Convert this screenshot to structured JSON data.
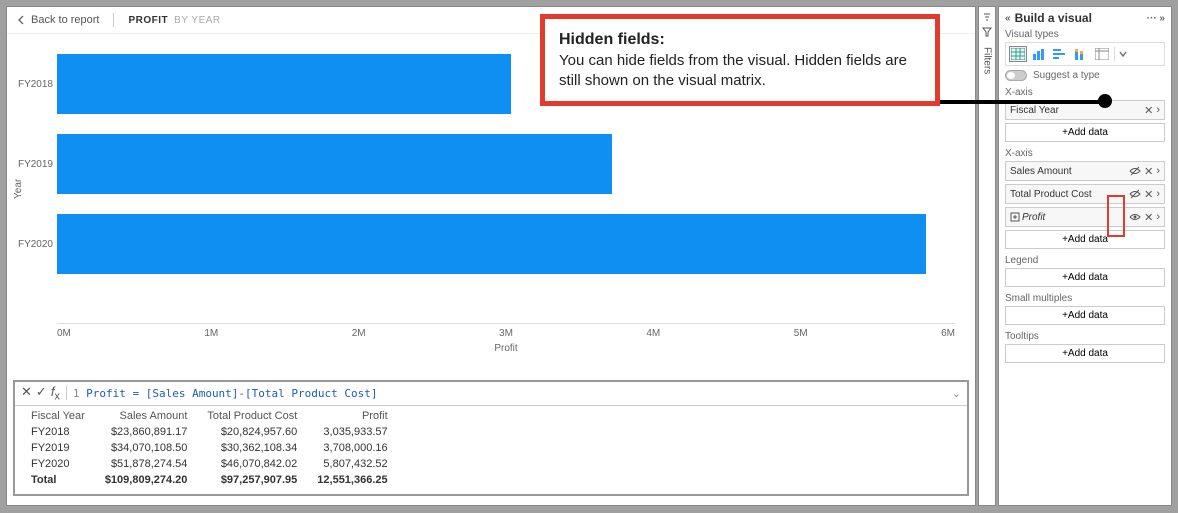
{
  "header": {
    "back_label": "Back to report",
    "crumb_active": "PROFIT",
    "crumb_inactive": "BY YEAR"
  },
  "callout": {
    "title": "Hidden fields:",
    "body": "You can hide fields from the visual. Hidden fields are still shown on the visual matrix."
  },
  "chart_data": {
    "type": "bar",
    "orientation": "horizontal",
    "categories": [
      "FY2018",
      "FY2019",
      "FY2020"
    ],
    "values": [
      3035934,
      3708000,
      5807433
    ],
    "xlabel": "Profit",
    "ylabel": "Year",
    "xlim": [
      0,
      6000000
    ],
    "xticks_labels": [
      "0M",
      "1M",
      "2M",
      "3M",
      "4M",
      "5M",
      "6M"
    ]
  },
  "formula": {
    "line_no": "1",
    "text": "Profit = [Sales Amount]-[Total Product Cost]"
  },
  "table": {
    "columns": [
      "Fiscal Year",
      "Sales Amount",
      "Total Product Cost",
      "Profit"
    ],
    "rows": [
      [
        "FY2018",
        "$23,860,891.17",
        "$20,824,957.60",
        "3,035,933.57"
      ],
      [
        "FY2019",
        "$34,070,108.50",
        "$30,362,108.34",
        "3,708,000.16"
      ],
      [
        "FY2020",
        "$51,878,274.54",
        "$46,070,842.02",
        "5,807,432.52"
      ]
    ],
    "total": [
      "Total",
      "$109,809,274.20",
      "$97,257,907.95",
      "12,551,366.25"
    ]
  },
  "filters_label": "Filters",
  "build": {
    "title": "Build a visual",
    "visual_types_label": "Visual types",
    "suggest_label": "Suggest a type",
    "add_data_label": "+Add data",
    "wells": {
      "xaxis_cat": {
        "label": "X-axis",
        "fields": [
          {
            "name": "Fiscal Year",
            "hidden": false,
            "measure": false
          }
        ]
      },
      "xaxis_val": {
        "label": "X-axis",
        "fields": [
          {
            "name": "Sales Amount",
            "hidden": true,
            "measure": false
          },
          {
            "name": "Total Product Cost",
            "hidden": true,
            "measure": false
          },
          {
            "name": "Profit",
            "hidden": false,
            "measure": true
          }
        ]
      },
      "legend": {
        "label": "Legend"
      },
      "small_multiples": {
        "label": "Small multiples"
      },
      "tooltips": {
        "label": "Tooltips"
      }
    }
  }
}
